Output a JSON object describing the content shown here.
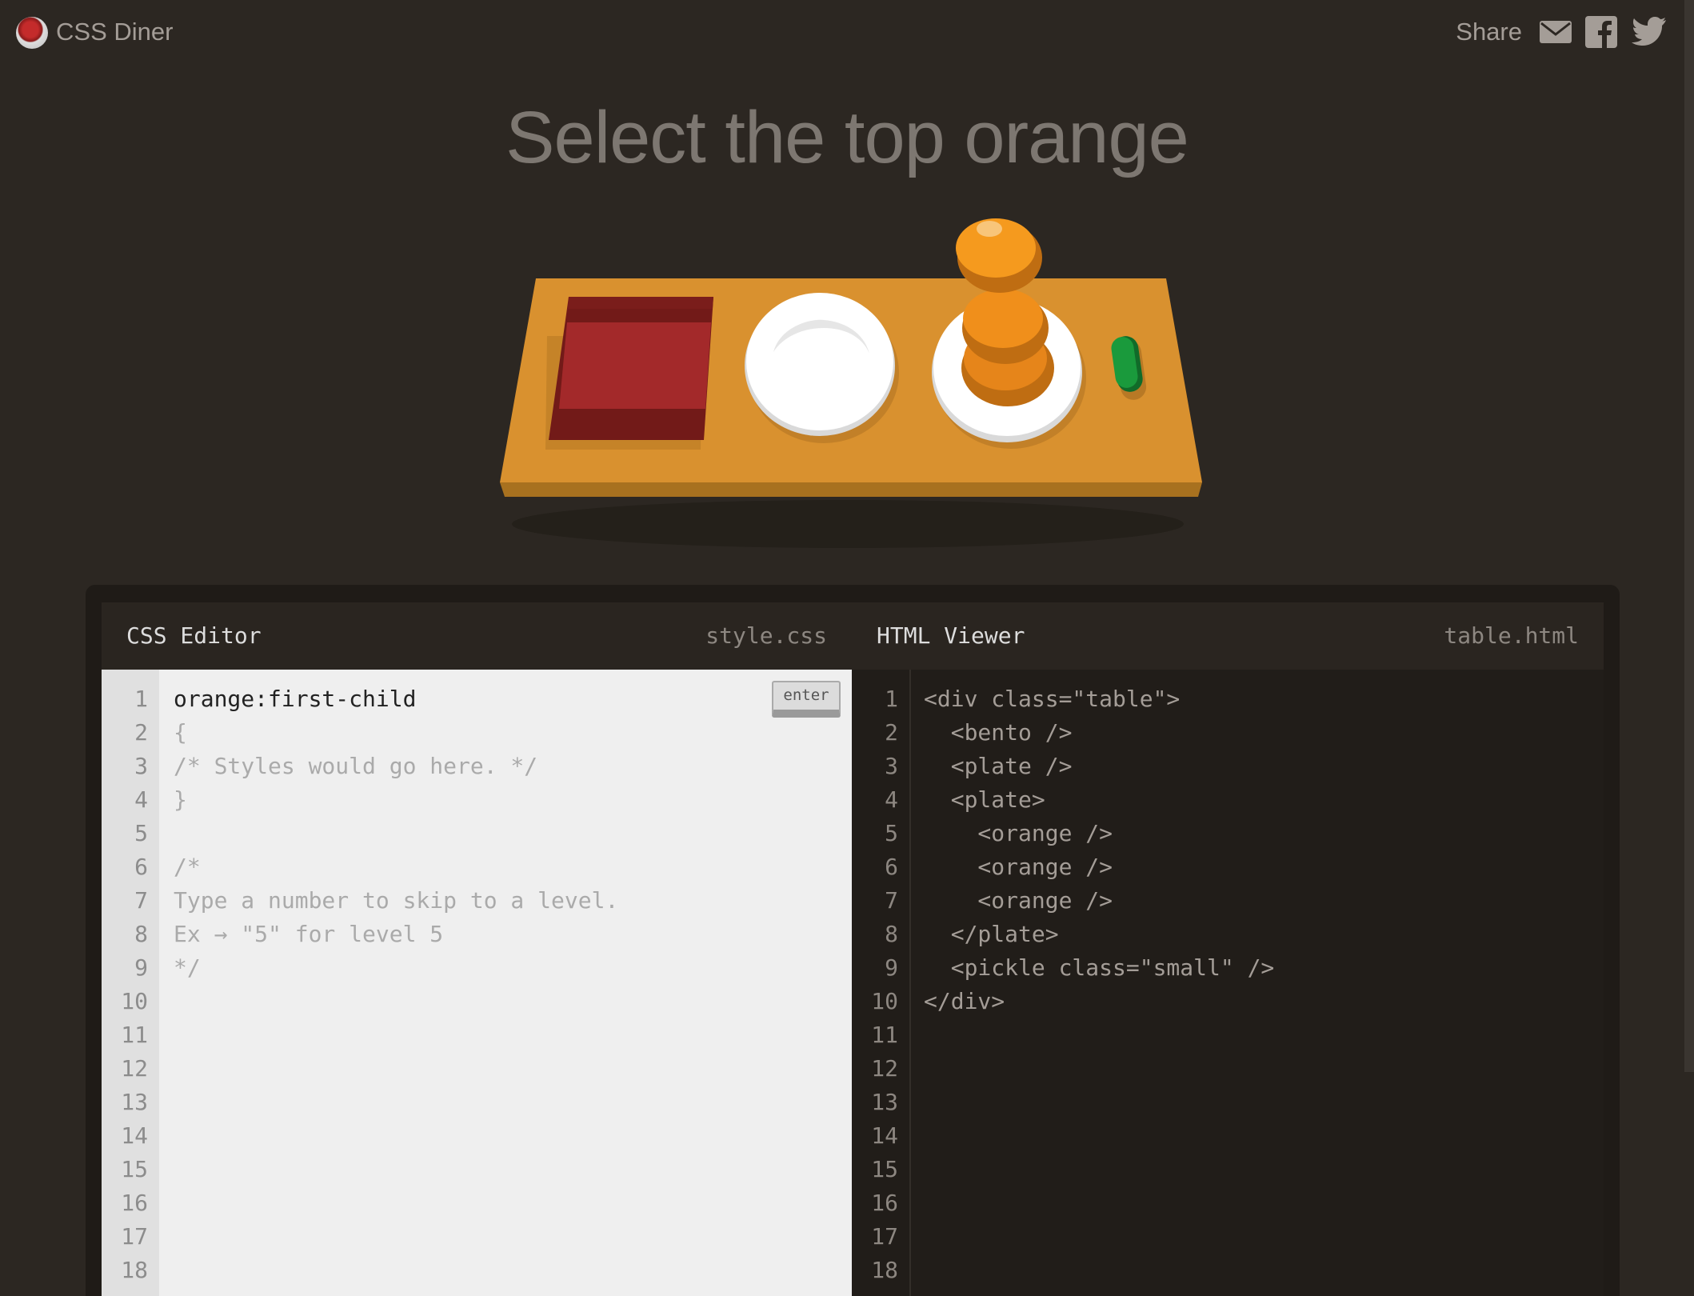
{
  "header": {
    "logo_text": "CSS Diner",
    "share_label": "Share"
  },
  "level": {
    "instruction": "Select the top orange"
  },
  "css_editor": {
    "title": "CSS Editor",
    "filename": "style.css",
    "enter_label": "enter",
    "line_numbers": [
      "1",
      "2",
      "3",
      "4",
      "5",
      "6",
      "7",
      "8",
      "9",
      "10",
      "11",
      "12",
      "13",
      "14",
      "15",
      "16",
      "17",
      "18"
    ],
    "input_value": "orange:first-child",
    "lines": [
      "{",
      "/* Styles would go here. */",
      "}",
      "",
      "/*",
      "Type a number to skip to a level.",
      "Ex → \"5\" for level 5",
      "*/"
    ]
  },
  "html_viewer": {
    "title": "HTML Viewer",
    "filename": "table.html",
    "line_numbers": [
      "1",
      "2",
      "3",
      "4",
      "5",
      "6",
      "7",
      "8",
      "9",
      "10",
      "11",
      "12",
      "13",
      "14",
      "15",
      "16",
      "17",
      "18"
    ],
    "lines": [
      "<div class=\"table\">",
      "  <bento />",
      "  <plate />",
      "  <plate>",
      "    <orange />",
      "    <orange />",
      "    <orange />",
      "  </plate>",
      "  <pickle class=\"small\" />",
      "</div>"
    ]
  },
  "colors": {
    "background": "#2c2722",
    "table": "#d9912f",
    "bento": "#a3292a",
    "orange": "#f59a1e",
    "pickle": "#1a9a3c"
  },
  "icons": [
    "logo-icon",
    "mail-icon",
    "facebook-icon",
    "twitter-icon"
  ]
}
